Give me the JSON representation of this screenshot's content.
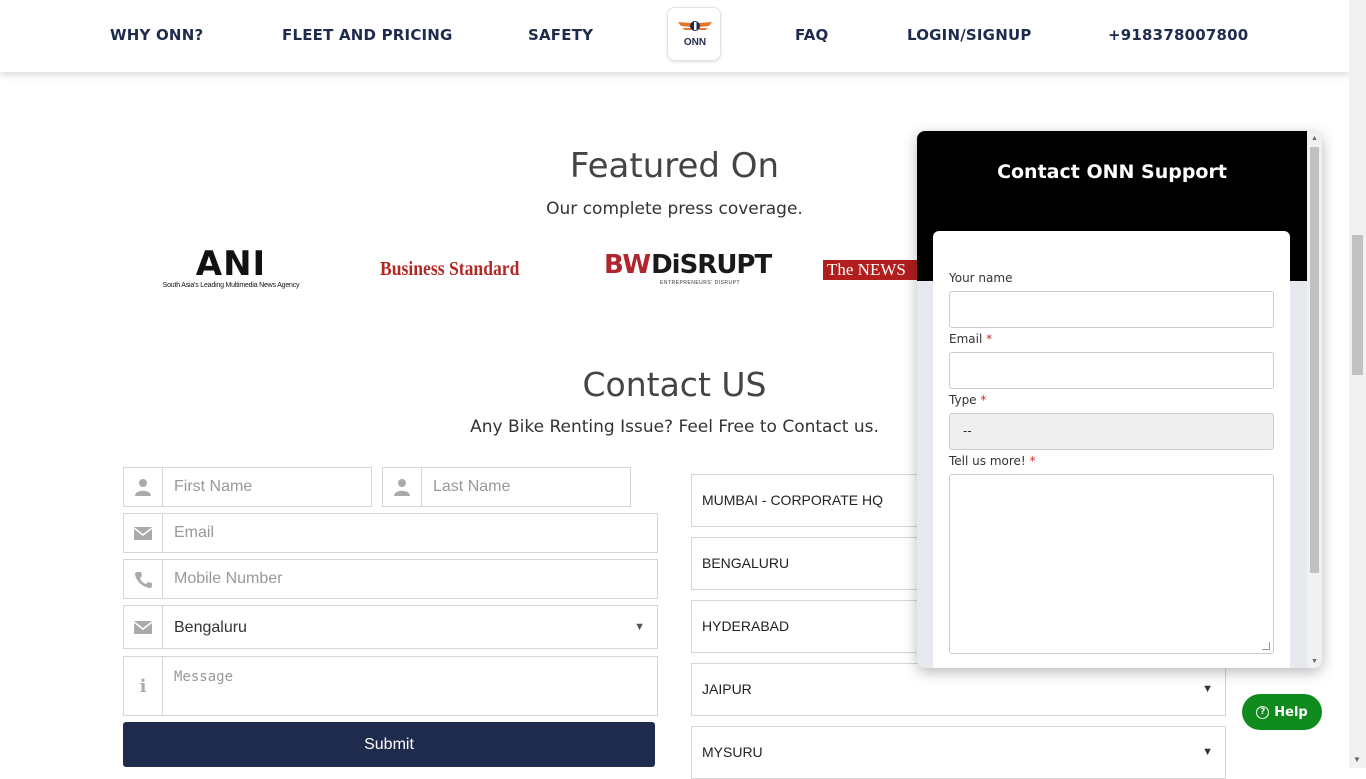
{
  "nav": {
    "items": [
      "WHY ONN?",
      "FLEET AND PRICING",
      "SAFETY",
      "FAQ",
      "LOGIN/SIGNUP",
      "+918378007800"
    ],
    "logo_text": "ONN"
  },
  "featured": {
    "title": "Featured On",
    "subtitle": "Our complete press coverage.",
    "ani": "ANI",
    "ani_tag": "South Asia's Leading Multimedia News Agency",
    "bs": "Business Standard",
    "bw": "BW",
    "bw_dis": "DiSRUPT",
    "bw_tag": "ENTREPRENEURS' DISRUPT",
    "news": "The NEWS"
  },
  "contact": {
    "title": "Contact US",
    "subtitle": "Any Bike Renting Issue? Feel Free to Contact us.",
    "first_name_ph": "First Name",
    "last_name_ph": "Last Name",
    "email_ph": "Email",
    "mobile_ph": "Mobile Number",
    "city_value": "Bengaluru",
    "message_ph": "Message",
    "submit": "Submit"
  },
  "cities": [
    "MUMBAI - CORPORATE HQ",
    "BENGALURU",
    "HYDERABAD",
    "JAIPUR",
    "MYSURU"
  ],
  "widget": {
    "title": "Contact ONN Support",
    "name_label": "Your name",
    "email_label": "Email",
    "type_label": "Type",
    "type_value": "--",
    "more_label": "Tell us more!",
    "required_mark": "*"
  },
  "help": {
    "label": "Help"
  },
  "colors": {
    "navy": "#1f2b4d",
    "help_green": "#0f8a1d",
    "required": "#d3262a"
  }
}
